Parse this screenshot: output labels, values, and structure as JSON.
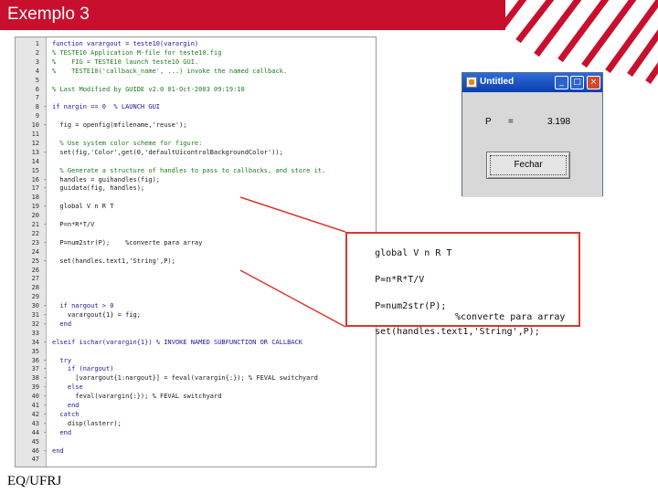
{
  "slide": {
    "title": "Exemplo 3",
    "footer": "EQ/UFRJ"
  },
  "colors": {
    "header_red": "#c8102e",
    "callout_red": "#d9372d",
    "titlebar_blue": "#0a3fb0"
  },
  "editor": {
    "lines": [
      {
        "n": "1",
        "dash": "",
        "code": "function varargout = teste10(varargin)",
        "cls": "kw"
      },
      {
        "n": "2",
        "dash": "",
        "code": "% TESTE10 Application M-file for teste10.fig",
        "cls": "cm"
      },
      {
        "n": "3",
        "dash": "",
        "code": "%    FIG = TESTE10 launch teste10 GUI.",
        "cls": "cm"
      },
      {
        "n": "4",
        "dash": "",
        "code": "%    TESTE10('callback_name', ...) invoke the named callback.",
        "cls": "cm"
      },
      {
        "n": "5",
        "dash": "",
        "code": "",
        "cls": ""
      },
      {
        "n": "6",
        "dash": "",
        "code": "% Last Modified by GUIDE v2.0 01-Oct-2003 09:19:10",
        "cls": "cm"
      },
      {
        "n": "7",
        "dash": "",
        "code": "",
        "cls": ""
      },
      {
        "n": "8",
        "dash": "-",
        "code": "if nargin == 0  % LAUNCH GUI",
        "cls": "kw"
      },
      {
        "n": "9",
        "dash": "",
        "code": "",
        "cls": ""
      },
      {
        "n": "10",
        "dash": "-",
        "code": "  fig = openfig(mfilename,'reuse');",
        "cls": ""
      },
      {
        "n": "11",
        "dash": "",
        "code": "",
        "cls": ""
      },
      {
        "n": "12",
        "dash": "",
        "code": "  % Use system color scheme for figure:",
        "cls": "cm"
      },
      {
        "n": "13",
        "dash": "-",
        "code": "  set(fig,'Color',get(0,'defaultUicontrolBackgroundColor'));",
        "cls": ""
      },
      {
        "n": "14",
        "dash": "",
        "code": "",
        "cls": ""
      },
      {
        "n": "15",
        "dash": "",
        "code": "  % Generate a structure of handles to pass to callbacks, and store it.",
        "cls": "cm"
      },
      {
        "n": "16",
        "dash": "-",
        "code": "  handles = guihandles(fig);",
        "cls": ""
      },
      {
        "n": "17",
        "dash": "-",
        "code": "  guidata(fig, handles);",
        "cls": ""
      },
      {
        "n": "18",
        "dash": "",
        "code": "",
        "cls": ""
      },
      {
        "n": "19",
        "dash": "-",
        "code": "  global V n R T",
        "cls": ""
      },
      {
        "n": "20",
        "dash": "",
        "code": "",
        "cls": ""
      },
      {
        "n": "21",
        "dash": "-",
        "code": "  P=n*R*T/V",
        "cls": ""
      },
      {
        "n": "22",
        "dash": "",
        "code": "",
        "cls": ""
      },
      {
        "n": "23",
        "dash": "-",
        "code": "  P=num2str(P);    %converte para array",
        "cls": ""
      },
      {
        "n": "24",
        "dash": "",
        "code": "",
        "cls": ""
      },
      {
        "n": "25",
        "dash": "-",
        "code": "  set(handles.text1,'String',P);",
        "cls": ""
      },
      {
        "n": "26",
        "dash": "",
        "code": "",
        "cls": ""
      },
      {
        "n": "27",
        "dash": "",
        "code": "",
        "cls": ""
      },
      {
        "n": "28",
        "dash": "",
        "code": "",
        "cls": ""
      },
      {
        "n": "29",
        "dash": "",
        "code": "",
        "cls": ""
      },
      {
        "n": "30",
        "dash": "-",
        "code": "  if nargout > 0",
        "cls": "kw"
      },
      {
        "n": "31",
        "dash": "-",
        "code": "    varargout{1} = fig;",
        "cls": ""
      },
      {
        "n": "32",
        "dash": "-",
        "code": "  end",
        "cls": "kw"
      },
      {
        "n": "33",
        "dash": "",
        "code": "",
        "cls": ""
      },
      {
        "n": "34",
        "dash": "-",
        "code": "elseif ischar(varargin{1}) % INVOKE NAMED SUBFUNCTION OR CALLBACK",
        "cls": "kw"
      },
      {
        "n": "35",
        "dash": "",
        "code": "",
        "cls": ""
      },
      {
        "n": "36",
        "dash": "-",
        "code": "  try",
        "cls": "kw"
      },
      {
        "n": "37",
        "dash": "-",
        "code": "    if (nargout)",
        "cls": "kw"
      },
      {
        "n": "38",
        "dash": "-",
        "code": "      [varargout{1:nargout}] = feval(varargin{:}); % FEVAL switchyard",
        "cls": ""
      },
      {
        "n": "39",
        "dash": "-",
        "code": "    else",
        "cls": "kw"
      },
      {
        "n": "40",
        "dash": "-",
        "code": "      feval(varargin{:}); % FEVAL switchyard",
        "cls": ""
      },
      {
        "n": "41",
        "dash": "-",
        "code": "    end",
        "cls": "kw"
      },
      {
        "n": "42",
        "dash": "-",
        "code": "  catch",
        "cls": "kw"
      },
      {
        "n": "43",
        "dash": "-",
        "code": "    disp(lasterr);",
        "cls": ""
      },
      {
        "n": "44",
        "dash": "-",
        "code": "  end",
        "cls": "kw"
      },
      {
        "n": "45",
        "dash": "",
        "code": "",
        "cls": ""
      },
      {
        "n": "46",
        "dash": "-",
        "code": "end",
        "cls": "kw"
      },
      {
        "n": "47",
        "dash": "",
        "code": "",
        "cls": ""
      }
    ]
  },
  "zoom": {
    "lines": [
      {
        "code": "global V n R T",
        "comment": ""
      },
      {
        "code": "P=n*R*T/V",
        "comment": ""
      },
      {
        "code": "P=num2str(P);",
        "comment": "%converte para array"
      },
      {
        "code": "set(handles.text1,'String',P);",
        "comment": ""
      }
    ]
  },
  "window": {
    "title": "Untitled",
    "label": "P",
    "equals": "=",
    "value": "3.198",
    "button_label": "Fechar",
    "minimize": "_",
    "maximize": "□",
    "close": "×"
  }
}
